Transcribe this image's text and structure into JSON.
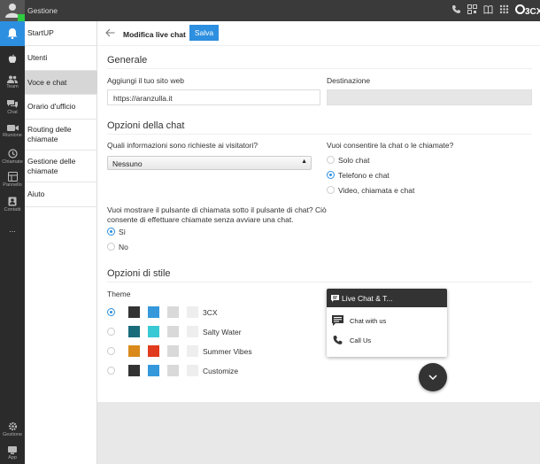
{
  "topbar": {
    "title": "Gestione",
    "brand": "3CX"
  },
  "rail": [
    {
      "name": "bell-icon",
      "label": ""
    },
    {
      "name": "apple-icon",
      "label": ""
    },
    {
      "name": "team-icon",
      "label": "Team"
    },
    {
      "name": "chat-icon",
      "label": "Chat"
    },
    {
      "name": "meeting-icon",
      "label": "Riunione"
    },
    {
      "name": "calls-icon",
      "label": "Chiamate"
    },
    {
      "name": "panel-icon",
      "label": "Pannello"
    },
    {
      "name": "contacts-icon",
      "label": "Contatti"
    },
    {
      "name": "more-icon",
      "label": "..."
    },
    {
      "name": "gear-icon",
      "label": "Gestione"
    },
    {
      "name": "app-icon",
      "label": "App"
    }
  ],
  "sidebar": {
    "items": [
      {
        "label": "StartUP"
      },
      {
        "label": "Utenti"
      },
      {
        "label": "Voce e chat"
      },
      {
        "label": "Orario d'ufficio"
      },
      {
        "label": "Routing delle chiamate"
      },
      {
        "label": "Gestione delle chiamate"
      },
      {
        "label": "Aiuto"
      }
    ]
  },
  "header": {
    "title": "Modifica live chat",
    "save_label": "Salva"
  },
  "general": {
    "title": "Generale",
    "website_label": "Aggiungi il tuo sito web",
    "website_value": "https://aranzulla.it",
    "destination_label": "Destinazione",
    "destination_value": ""
  },
  "chat_options": {
    "title": "Opzioni della chat",
    "info_label": "Quali informazioni sono richieste ai visitatori?",
    "info_value": "Nessuno",
    "mode_label": "Vuoi consentire la chat o le chiamate?",
    "mode_options": [
      "Solo chat",
      "Telefono e chat",
      "Video, chiamata e chat"
    ],
    "mode_selected": 1,
    "callbtn_label_1": "Vuoi mostrare il pulsante di chiamata sotto il pulsante di chat? Ciò",
    "callbtn_label_2": "consente di effettuare chiamate senza avviare una chat.",
    "callbtn_options": [
      "Sì",
      "No"
    ],
    "callbtn_selected": 0
  },
  "style_options": {
    "title": "Opzioni di stile",
    "theme_label": "Theme",
    "themes": [
      {
        "name": "3CX",
        "colors": [
          "#333333",
          "#3498db",
          "#d9d9d9",
          "#eeeeee"
        ]
      },
      {
        "name": "Salty Water",
        "colors": [
          "#196c7a",
          "#39c9d4",
          "#d9d9d9",
          "#eeeeee"
        ]
      },
      {
        "name": "Summer Vibes",
        "colors": [
          "#d98a1b",
          "#e03b1c",
          "#d9d9d9",
          "#eeeeee"
        ]
      },
      {
        "name": "Customize",
        "colors": [
          "#333333",
          "#3498db",
          "#d9d9d9",
          "#eeeeee"
        ]
      }
    ],
    "selected_theme": 0
  },
  "widget": {
    "title": "Live Chat & T...",
    "options": [
      "Chat with us",
      "Call Us"
    ]
  },
  "colors": {
    "accent": "#2d8fe0",
    "dark": "#333333",
    "online": "#2ecc40"
  }
}
